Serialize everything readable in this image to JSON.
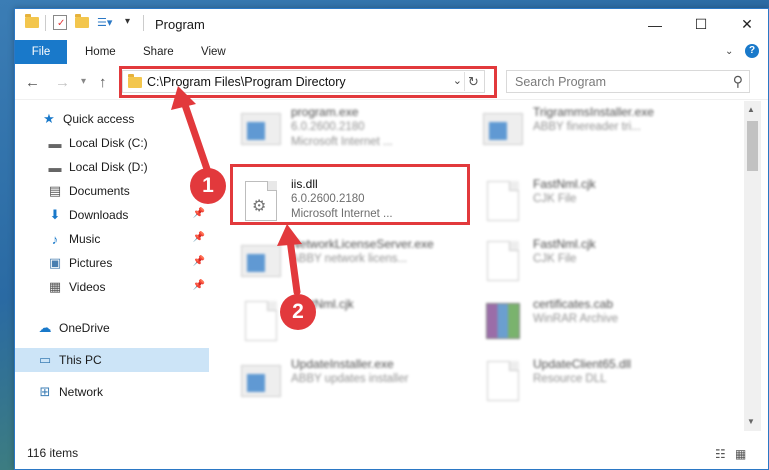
{
  "window": {
    "title": "Program"
  },
  "ribbon": {
    "tabs": [
      "File",
      "Home",
      "Share",
      "View"
    ]
  },
  "address": {
    "path": "C:\\Program Files\\Program Directory"
  },
  "search": {
    "placeholder": "Search Program"
  },
  "nav": [
    {
      "label": "Quick access",
      "icon": "star-icon",
      "pinned": false
    },
    {
      "label": "Local Disk (C:)",
      "icon": "drive-icon",
      "pinned": false
    },
    {
      "label": "Local Disk (D:)",
      "icon": "drive-icon",
      "pinned": false
    },
    {
      "label": "Documents",
      "icon": "documents-icon",
      "pinned": false
    },
    {
      "label": "Downloads",
      "icon": "download-icon",
      "pinned": true
    },
    {
      "label": "Music",
      "icon": "music-icon",
      "pinned": true
    },
    {
      "label": "Pictures",
      "icon": "pictures-icon",
      "pinned": true
    },
    {
      "label": "Videos",
      "icon": "videos-icon",
      "pinned": true
    },
    {
      "label": "OneDrive",
      "icon": "cloud-icon",
      "pinned": false
    },
    {
      "label": "This PC",
      "icon": "computer-icon",
      "pinned": false,
      "selected": true
    },
    {
      "label": "Network",
      "icon": "network-icon",
      "pinned": false
    }
  ],
  "files": [
    {
      "name": "program.exe",
      "line2": "6.0.2600.2180",
      "line3": "Microsoft Internet ...",
      "icon": "exe-icon"
    },
    {
      "name": "TrigrammsInstaller.exe",
      "line2": "ABBY finereader tri...",
      "line3": "",
      "icon": "installer-icon"
    },
    {
      "name": "iis.dll",
      "line2": "6.0.2600.2180",
      "line3": "Microsoft Internet ...",
      "icon": "dll-gear-icon",
      "highlighted": true
    },
    {
      "name": "FastNml.cjk",
      "line2": "CJK File",
      "line3": "",
      "icon": "file-icon"
    },
    {
      "name": "NetworkLicenseServer.exe",
      "line2": "ABBY network licens...",
      "line3": "",
      "icon": "installer-icon"
    },
    {
      "name": "FastNml.cjk",
      "line2": "CJK File",
      "line3": "",
      "icon": "file-icon"
    },
    {
      "name": "FastNml.cjk",
      "line2": "",
      "line3": "",
      "icon": "file-icon"
    },
    {
      "name": "certificates.cab",
      "line2": "WinRAR Archive",
      "line3": "",
      "icon": "archive-icon"
    },
    {
      "name": "UpdateInstaller.exe",
      "line2": "ABBY updates installer",
      "line3": "",
      "icon": "installer-icon"
    },
    {
      "name": "UpdateClient65.dll",
      "line2": "Resource DLL",
      "line3": "",
      "icon": "dll-icon"
    }
  ],
  "status": {
    "count": "116 items"
  },
  "annotations": {
    "step1": "1",
    "step2": "2",
    "color": "#e2393c"
  },
  "colors": {
    "accent": "#1979ca",
    "selection": "#cce4f7"
  }
}
